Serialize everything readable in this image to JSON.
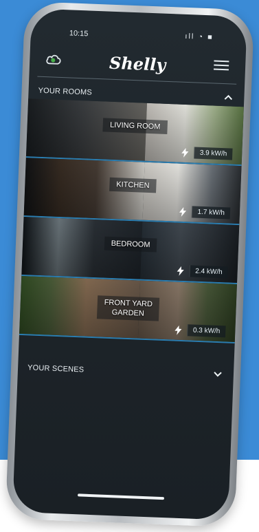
{
  "status": {
    "time": "10:15",
    "icons": "ıll ◔ ■"
  },
  "header": {
    "logo": "Shelly"
  },
  "rooms_section": {
    "title": "YOUR ROOMS"
  },
  "scenes_section": {
    "title": "YOUR SCENES"
  },
  "rooms": [
    {
      "name": "LIVING ROOM",
      "energy": "3.9 kW/h"
    },
    {
      "name": "KITCHEN",
      "energy": "1.7 kW/h"
    },
    {
      "name": "BEDROOM",
      "energy": "2.4 kW/h"
    },
    {
      "name": "FRONT YARD\nGARDEN",
      "energy": "0.3 kW/h"
    }
  ],
  "colors": {
    "background": "#3b8bd6",
    "accent": "#2a7db0",
    "screen": "#1d2429",
    "text": "#ffffff"
  },
  "icons": {
    "cloud": "cloud-icon",
    "menu": "menu-icon",
    "chevron_up": "chevron-up-icon",
    "chevron_down": "chevron-down-icon",
    "bolt": "bolt-icon"
  }
}
